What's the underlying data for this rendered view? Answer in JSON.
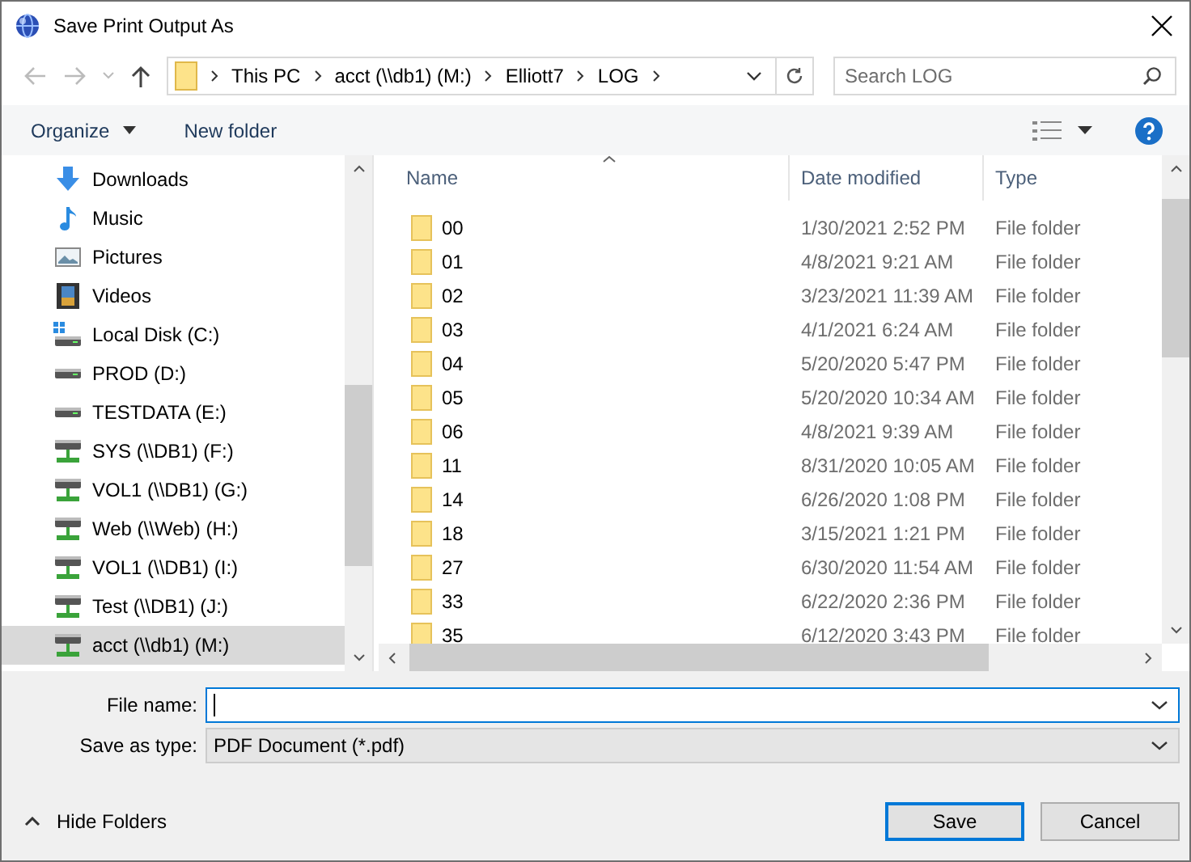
{
  "window": {
    "title": "Save Print Output As"
  },
  "address": {
    "crumbs": [
      "This PC",
      "acct (\\\\db1) (M:)",
      "Elliott7",
      "LOG"
    ]
  },
  "search": {
    "placeholder": "Search LOG"
  },
  "toolbar": {
    "organize": "Organize",
    "new_folder": "New folder"
  },
  "sidebar": {
    "items": [
      {
        "label": "Downloads",
        "kind": "downloads",
        "selected": false
      },
      {
        "label": "Music",
        "kind": "music",
        "selected": false
      },
      {
        "label": "Pictures",
        "kind": "pictures",
        "selected": false
      },
      {
        "label": "Videos",
        "kind": "videos",
        "selected": false
      },
      {
        "label": "Local Disk (C:)",
        "kind": "system-drive",
        "selected": false
      },
      {
        "label": "PROD (D:)",
        "kind": "drive",
        "selected": false
      },
      {
        "label": "TESTDATA (E:)",
        "kind": "drive",
        "selected": false
      },
      {
        "label": "SYS (\\\\DB1) (F:)",
        "kind": "network-drive",
        "selected": false
      },
      {
        "label": "VOL1 (\\\\DB1) (G:)",
        "kind": "network-drive",
        "selected": false
      },
      {
        "label": "Web (\\\\Web) (H:)",
        "kind": "network-drive",
        "selected": false
      },
      {
        "label": "VOL1 (\\\\DB1) (I:)",
        "kind": "network-drive",
        "selected": false
      },
      {
        "label": "Test (\\\\DB1) (J:)",
        "kind": "network-drive",
        "selected": false
      },
      {
        "label": "acct (\\\\db1) (M:)",
        "kind": "network-drive",
        "selected": true
      }
    ]
  },
  "table": {
    "columns": [
      "Name",
      "Date modified",
      "Type"
    ],
    "rows": [
      {
        "name": "00",
        "date": "1/30/2021 2:52 PM",
        "type": "File folder"
      },
      {
        "name": "01",
        "date": "4/8/2021 9:21 AM",
        "type": "File folder"
      },
      {
        "name": "02",
        "date": "3/23/2021 11:39 AM",
        "type": "File folder"
      },
      {
        "name": "03",
        "date": "4/1/2021 6:24 AM",
        "type": "File folder"
      },
      {
        "name": "04",
        "date": "5/20/2020 5:47 PM",
        "type": "File folder"
      },
      {
        "name": "05",
        "date": "5/20/2020 10:34 AM",
        "type": "File folder"
      },
      {
        "name": "06",
        "date": "4/8/2021 9:39 AM",
        "type": "File folder"
      },
      {
        "name": "11",
        "date": "8/31/2020 10:05 AM",
        "type": "File folder"
      },
      {
        "name": "14",
        "date": "6/26/2020 1:08 PM",
        "type": "File folder"
      },
      {
        "name": "18",
        "date": "3/15/2021 1:21 PM",
        "type": "File folder"
      },
      {
        "name": "27",
        "date": "6/30/2020 11:54 AM",
        "type": "File folder"
      },
      {
        "name": "33",
        "date": "6/22/2020 2:36 PM",
        "type": "File folder"
      },
      {
        "name": "35",
        "date": "6/12/2020 3:43 PM",
        "type": "File folder"
      }
    ]
  },
  "form": {
    "file_name_label": "File name:",
    "type_label": "Save as type:",
    "type_value": "PDF Document (*.pdf)"
  },
  "hide_folders": "Hide Folders",
  "buttons": [
    "Save",
    "Cancel"
  ]
}
